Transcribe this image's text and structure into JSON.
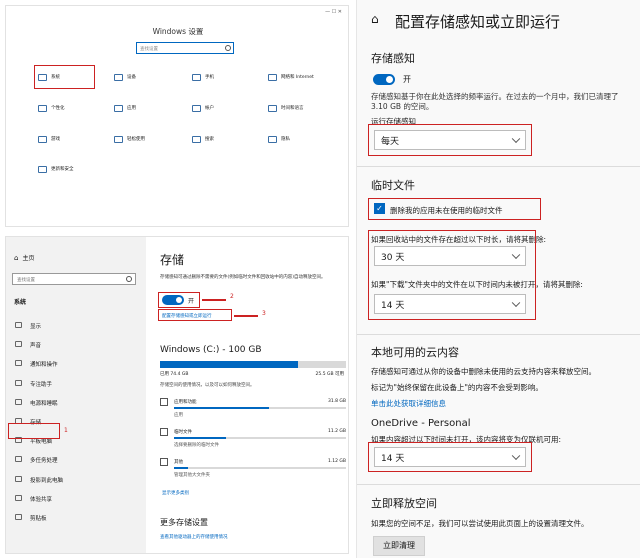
{
  "panel1": {
    "title": "Windows 设置",
    "search_placeholder": "查找设置",
    "categories": [
      {
        "label": "系统",
        "icon": "laptop-icon"
      },
      {
        "label": "设备",
        "icon": "keyboard-icon"
      },
      {
        "label": "手机",
        "icon": "phone-icon"
      },
      {
        "label": "网络和 Internet",
        "icon": "globe-icon"
      },
      {
        "label": "个性化",
        "icon": "brush-icon"
      },
      {
        "label": "应用",
        "icon": "apps-icon"
      },
      {
        "label": "帐户",
        "icon": "person-icon"
      },
      {
        "label": "时间和语言",
        "icon": "clock-icon"
      },
      {
        "label": "游戏",
        "icon": "gamepad-icon"
      },
      {
        "label": "轻松使用",
        "icon": "accessibility-icon"
      },
      {
        "label": "搜索",
        "icon": "search-icon"
      },
      {
        "label": "隐私",
        "icon": "lock-icon"
      },
      {
        "label": "更新和安全",
        "icon": "sync-icon"
      }
    ]
  },
  "panel2": {
    "sidebar": {
      "home": "主页",
      "search_placeholder": "查找设置",
      "section": "系统",
      "items": [
        {
          "label": "显示",
          "icon": "monitor-icon"
        },
        {
          "label": "声音",
          "icon": "speaker-icon"
        },
        {
          "label": "通知和操作",
          "icon": "notification-icon"
        },
        {
          "label": "专注助手",
          "icon": "moon-icon"
        },
        {
          "label": "电源和睡眠",
          "icon": "power-icon"
        },
        {
          "label": "存储",
          "icon": "storage-icon"
        },
        {
          "label": "平板电脑",
          "icon": "tablet-icon"
        },
        {
          "label": "多任务处理",
          "icon": "multitask-icon"
        },
        {
          "label": "投影到此电脑",
          "icon": "project-icon"
        },
        {
          "label": "体验共享",
          "icon": "share-icon"
        },
        {
          "label": "剪贴板",
          "icon": "clipboard-icon"
        }
      ]
    },
    "main": {
      "title": "存储",
      "description": "存储感知可通过删除不需要的文件(例如临时文件和回收站中的内容)自动释放空间。",
      "toggle_label": "开",
      "configure_link": "配置存储感知或立即运行",
      "drive_title": "Windows (C:) - 100 GB",
      "used": "已用 74.4 GB",
      "free": "25.5 GB 可用",
      "drive_fill": 0.744,
      "usage_note": "存储空间的使用情况，以及可以如何释放空间。",
      "items": [
        {
          "label": "应用和功能",
          "size": "31.8 GB",
          "fill": 0.55,
          "icon": "apps-list-icon"
        },
        {
          "label": "临时文件",
          "size": "11.2 GB",
          "fill": 0.3,
          "icon": "trash-icon"
        },
        {
          "label": "其他",
          "size": "1.12 GB",
          "fill": 0.08,
          "icon": "folder-icon"
        }
      ],
      "item_notes": [
        "应用",
        "选择要删除的临时文件",
        "管理其他大文件夹"
      ],
      "more_categories": "显示更多类别",
      "more_title": "更多存储设置",
      "more_link": "查看其他驱动器上的存储使用情况"
    },
    "annotations": [
      "1",
      "2",
      "3"
    ]
  },
  "panel3": {
    "title": "配置存储感知或立即运行",
    "sense": {
      "heading": "存储感知",
      "toggle_label": "开",
      "description": "存储感知基于你在此处选择的频率运行。在过去的一个月中，我们已清理了 3.10 GB 的空间。",
      "run_label": "运行存储感知",
      "run_value": "每天"
    },
    "temp": {
      "heading": "临时文件",
      "checkbox_label": "删除我的应用未在使用的临时文件",
      "recycle_label": "如果回收站中的文件存在超过以下时长，请将其删除:",
      "recycle_value": "30 天",
      "downloads_label": "如果\"下载\"文件夹中的文件在以下时间内未被打开，请将其删除:",
      "downloads_value": "14 天"
    },
    "cloud": {
      "heading": "本地可用的云内容",
      "description": "存储感知可通过从你的设备中删除未使用的云支持内容来释放空间。",
      "note": "标记为\"始终保留在此设备上\"的内容不会受到影响。",
      "link": "单击此处获取详细信息",
      "onedrive_title": "OneDrive - Personal",
      "onedrive_label": "如果内容超过以下时间未打开，该内容将变为仅联机可用:",
      "onedrive_value": "14 天"
    },
    "free": {
      "heading": "立即释放空间",
      "description": "如果您的空间不足，我们可以尝试使用此页面上的设置清理文件。",
      "button": "立即清理"
    }
  }
}
